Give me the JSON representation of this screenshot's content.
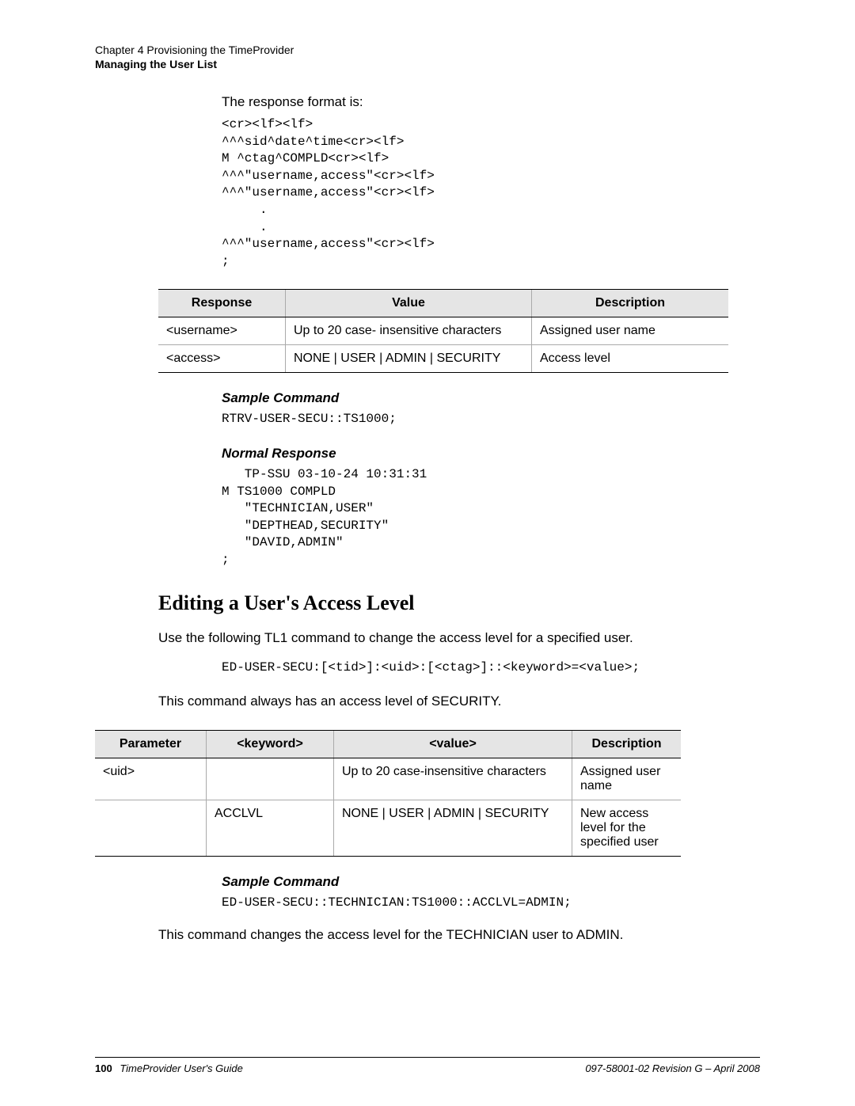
{
  "header": {
    "chapter": "Chapter 4 Provisioning the TimeProvider",
    "section": "Managing the User List"
  },
  "intro": {
    "response_format_label": "The response format is:",
    "response_format_code": "<cr><lf><lf>\n^^^sid^date^time<cr><lf>\nM ^ctag^COMPLD<cr><lf>\n^^^\"username,access\"<cr><lf>\n^^^\"username,access\"<cr><lf>\n     .\n     .\n^^^\"username,access\"<cr><lf>\n;"
  },
  "table1": {
    "headers": [
      "Response",
      "Value",
      "Description"
    ],
    "rows": [
      [
        "<username>",
        "Up to 20 case- insensitive characters",
        "Assigned user name"
      ],
      [
        "<access>",
        "NONE | USER | ADMIN | SECURITY",
        "Access level"
      ]
    ]
  },
  "sample1": {
    "heading": "Sample Command",
    "code": "RTRV-USER-SECU::TS1000;"
  },
  "normal": {
    "heading": "Normal Response",
    "code": "   TP-SSU 03-10-24 10:31:31\nM TS1000 COMPLD\n   \"TECHNICIAN,USER\"\n   \"DEPTHEAD,SECURITY\"\n   \"DAVID,ADMIN\"\n;"
  },
  "main_heading": "Editing a User's Access Level",
  "desc1": "Use the following TL1 command to change the access level for a specified user.",
  "command_code": "ED-USER-SECU:[<tid>]:<uid>:[<ctag>]::<keyword>=<value>;",
  "desc2": "This command always has an access level of SECURITY.",
  "table2": {
    "headers": [
      "Parameter",
      "<keyword>",
      "<value>",
      "Description"
    ],
    "rows": [
      [
        "<uid>",
        "",
        "Up to 20 case-insensitive characters",
        "Assigned user name"
      ],
      [
        "",
        "ACCLVL",
        "NONE | USER | ADMIN | SECURITY",
        "New access level for the specified user"
      ]
    ]
  },
  "sample2": {
    "heading": "Sample Command",
    "code": "ED-USER-SECU::TECHNICIAN:TS1000::ACCLVL=ADMIN;"
  },
  "desc3": "This command changes the access level for the TECHNICIAN user to ADMIN.",
  "footer": {
    "page_number": "100",
    "guide": "TimeProvider User's Guide",
    "revision": "097-58001-02 Revision G – April 2008"
  }
}
